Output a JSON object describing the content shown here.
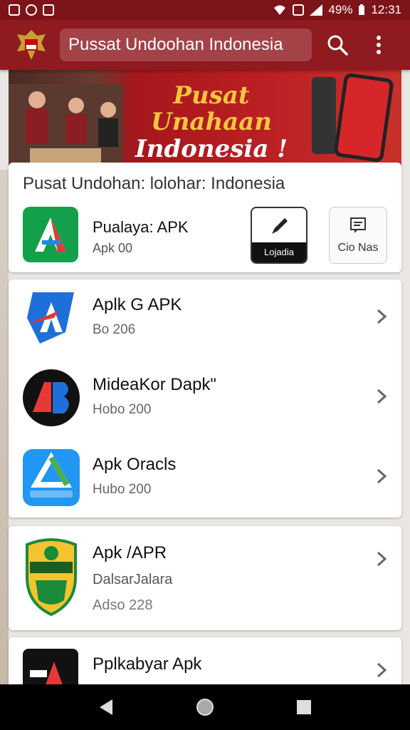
{
  "status_bar": {
    "battery": "49%",
    "time": "12:31"
  },
  "app_bar": {
    "title": "Pussat Undoohan  Indonesia",
    "icons": [
      "emblem-icon",
      "search-icon",
      "overflow-menu-icon"
    ]
  },
  "banner": {
    "line1": "Pusat Unahaan",
    "line2": "Indonesia !"
  },
  "featured": {
    "title": "Pusat Undohan: lolohar: Indonesia",
    "app_name": "Pualaya: APK",
    "app_sub": "Apk 00",
    "install_label": "Lojadia",
    "info_label": "Cio Nas"
  },
  "apps": [
    {
      "name": "Aplk G APK",
      "sub": "Bo 206",
      "icon": "blue-arrow-icon"
    },
    {
      "name": "MideaKor Dapk\"",
      "sub": "Hobo 200",
      "icon": "ab-logo-icon"
    },
    {
      "name": "Apk Oracls",
      "sub": "Hubo 200",
      "icon": "triangle-logo-icon"
    }
  ],
  "single_app": {
    "name": "Apk /APR",
    "sub1": "DalsarJalara",
    "sub2": "Adso 228",
    "icon": "shield-badge-icon"
  },
  "partial_app": {
    "name": "Pplkabyar Apk",
    "icon": "dark-logo-icon"
  },
  "colors": {
    "primary": "#8f1a20",
    "status": "#7d1419",
    "accent_gold": "#f5c542"
  }
}
